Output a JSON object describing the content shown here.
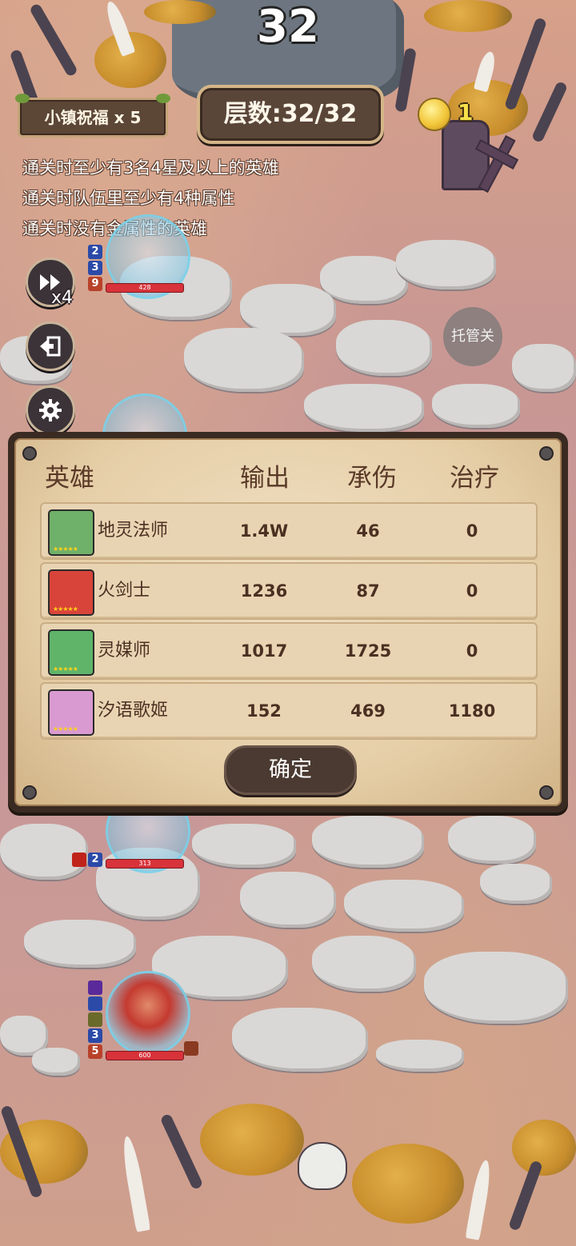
{
  "round_counter": "32",
  "blessing_label": "小镇祝福 x 5",
  "floor_label": "层数:32/32",
  "coins": "1",
  "conditions": [
    "通关时至少有3名4星及以上的英雄",
    "通关时队伍里至少有4种属性",
    "通关时没有金属性的英雄"
  ],
  "speed_multiplier": "x4",
  "auto_label": "托管关",
  "units": {
    "mage": {
      "hp": "428",
      "levels": [
        "2",
        "3",
        "9"
      ]
    },
    "middle": {
      "hp": "313",
      "levels": [
        "2"
      ]
    },
    "swordsman": {
      "hp": "600",
      "levels": [
        "3",
        "5"
      ]
    }
  },
  "stats_panel": {
    "headers": {
      "hero": "英雄",
      "damage": "输出",
      "tank": "承伤",
      "heal": "治疗"
    },
    "rows": [
      {
        "name": "地灵法师",
        "damage": "1.4W",
        "tank": "46",
        "heal": "0",
        "portrait_color": "#6fb06a"
      },
      {
        "name": "火剑士",
        "damage": "1236",
        "tank": "87",
        "heal": "0",
        "portrait_color": "#d8443a"
      },
      {
        "name": "灵媒师",
        "damage": "1017",
        "tank": "1725",
        "heal": "0",
        "portrait_color": "#5fb46a"
      },
      {
        "name": "汐语歌姬",
        "damage": "152",
        "tank": "469",
        "heal": "1180",
        "portrait_color": "#d89ad0"
      }
    ],
    "confirm_label": "确定"
  },
  "colors": {
    "panel_frame": "#3a2b22",
    "parchment": "#e6cfa8",
    "text_brown": "#4a3022",
    "coin_text": "#f7e04a"
  }
}
